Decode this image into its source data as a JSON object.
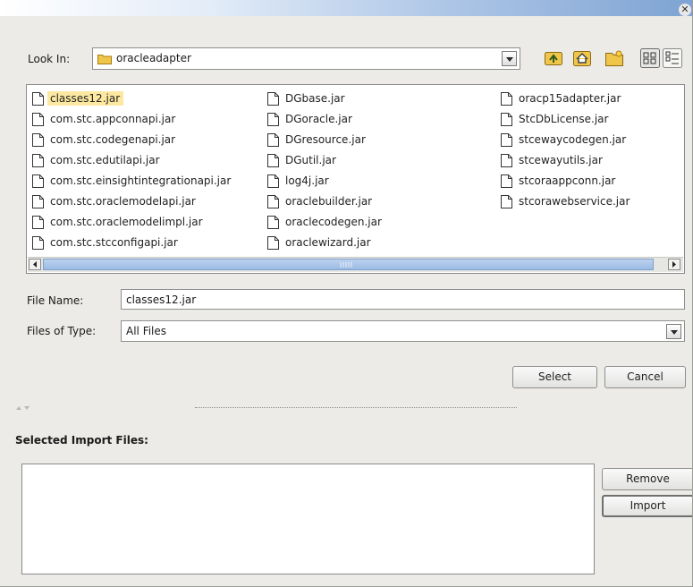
{
  "window": {
    "close_icon": "close-icon"
  },
  "look_in": {
    "label": "Look In:",
    "value": "oracleadapter"
  },
  "toolbar": {
    "icons": [
      "up-folder-icon",
      "home-icon",
      "new-folder-icon",
      "list-view-icon",
      "details-view-icon"
    ]
  },
  "files": {
    "columns": [
      [
        "classes12.jar",
        "com.stc.appconnapi.jar",
        "com.stc.codegenapi.jar",
        "com.stc.edutilapi.jar",
        "com.stc.einsightintegrationapi.jar",
        "com.stc.oraclemodelapi.jar",
        "com.stc.oraclemodelimpl.jar",
        "com.stc.stcconfigapi.jar"
      ],
      [
        "DGbase.jar",
        "DGoracle.jar",
        "DGresource.jar",
        "DGutil.jar",
        "log4j.jar",
        "oraclebuilder.jar",
        "oraclecodegen.jar",
        "oraclewizard.jar"
      ],
      [
        "oracp15adapter.jar",
        "StcDbLicense.jar",
        "stcewaycodegen.jar",
        "stcewayutils.jar",
        "stcoraappconn.jar",
        "stcorawebservice.jar"
      ]
    ],
    "selected": "classes12.jar"
  },
  "file_name": {
    "label": "File Name:",
    "value": "classes12.jar"
  },
  "file_type": {
    "label": "Files of Type:",
    "value": "All Files"
  },
  "buttons": {
    "select": "Select",
    "cancel": "Cancel",
    "remove": "Remove",
    "import": "Import"
  },
  "import_section": {
    "title": "Selected Import Files:"
  },
  "colors": {
    "selection": "#fce8a0",
    "thumb": "#9bbbe3",
    "folder": "#f0c64a"
  }
}
